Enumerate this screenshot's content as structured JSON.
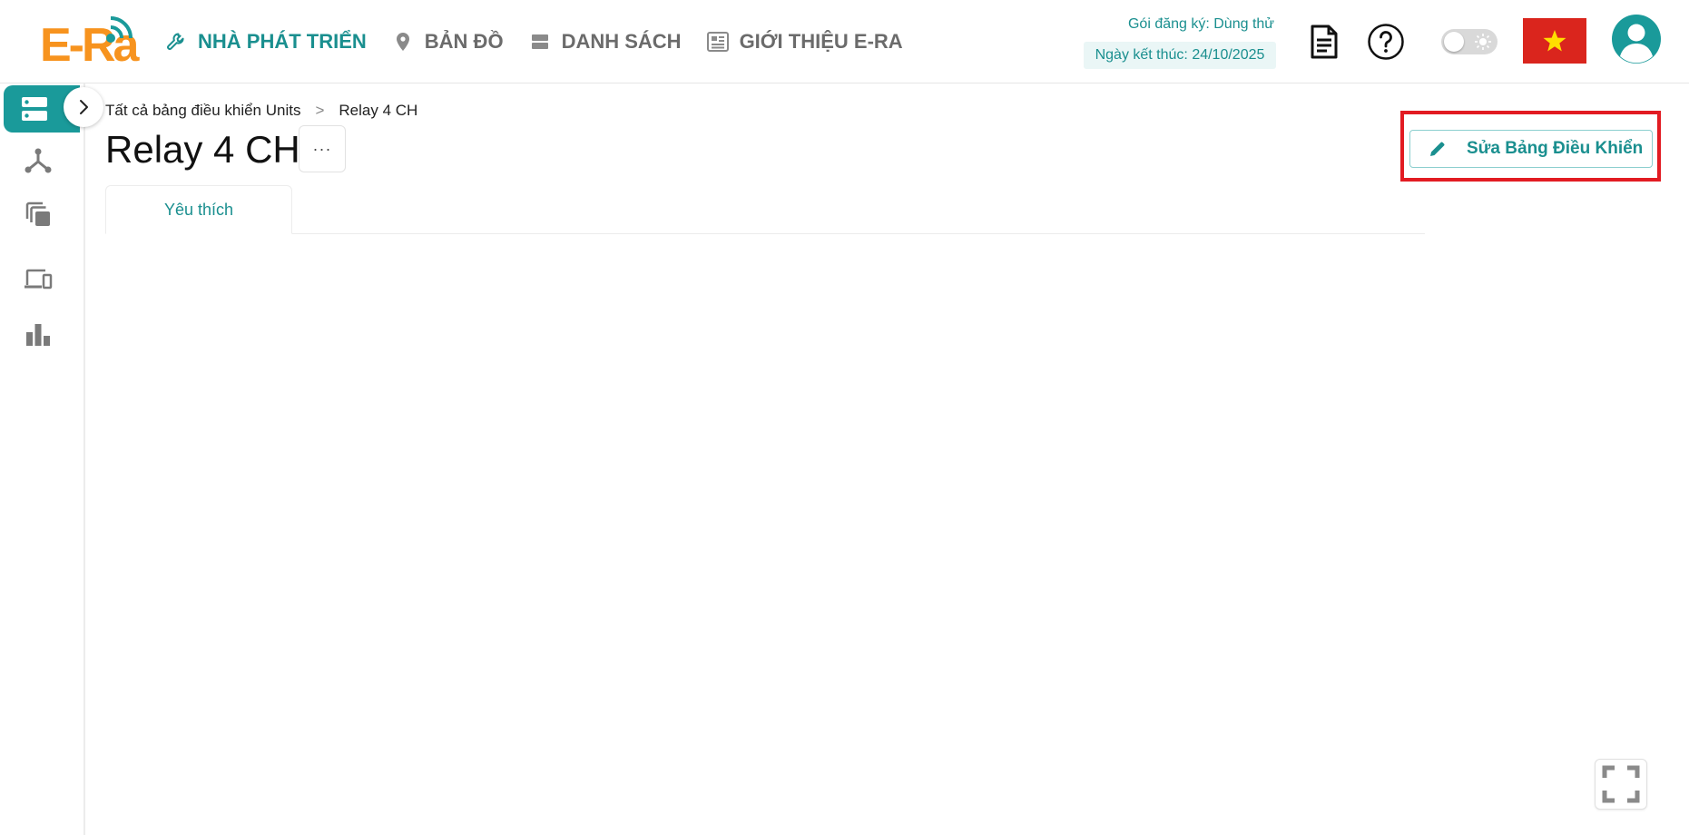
{
  "brand": {
    "logo_text": "E-Ra",
    "accent": "#1a8f8f",
    "logo_color": "#f7931e"
  },
  "nav": {
    "items": [
      {
        "label": "NHÀ PHÁT TRIỂN",
        "icon": "wrench-icon",
        "active": true
      },
      {
        "label": "BẢN ĐỒ",
        "icon": "map-pin-icon",
        "active": false
      },
      {
        "label": "DANH SÁCH",
        "icon": "list-icon",
        "active": false
      },
      {
        "label": "GIỚI THIỆU E-RA",
        "icon": "newspaper-icon",
        "active": false
      }
    ]
  },
  "subscription": {
    "plan": "Gói đăng ký: Dùng thử",
    "end_date": "Ngày kết thúc: 24/10/2025"
  },
  "header_icons": [
    "document-icon",
    "help-icon",
    "theme-toggle",
    "vietnam-flag-icon",
    "user-avatar-icon"
  ],
  "sidebar": {
    "items": [
      "dashboard-icon",
      "network-icon",
      "copy-icon",
      "devices-icon",
      "bar-chart-icon"
    ],
    "expand_icon": "chevron-right-icon"
  },
  "breadcrumb": {
    "parent": "Tất cả bảng điều khiển Units",
    "separator": ">",
    "current": "Relay 4 CH"
  },
  "page": {
    "title": "Relay 4 CH",
    "more_label": "···",
    "edit_button_label": "Sửa Bảng Điều Khiển"
  },
  "tabs": [
    {
      "label": "Yêu thích",
      "active": true
    }
  ],
  "colors": {
    "highlight": "#e21b22",
    "flag_red": "#da251d",
    "flag_star": "#ffde00"
  }
}
